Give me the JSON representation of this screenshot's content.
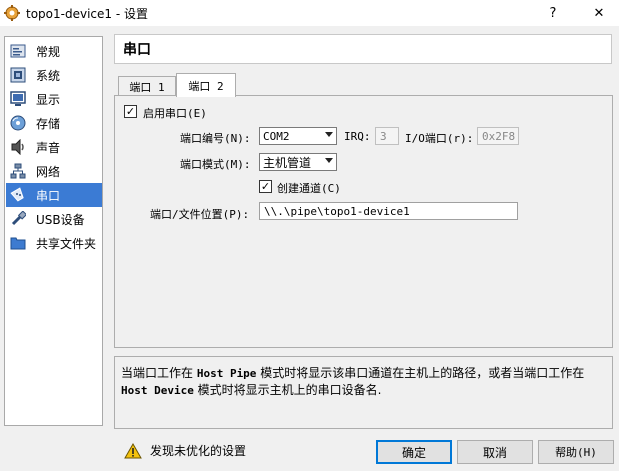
{
  "window": {
    "title": "topo1-device1 - 设置",
    "help_glyph": "?",
    "close_glyph": "✕"
  },
  "sidebar": {
    "items": [
      {
        "label": "常规",
        "icon": "general-icon"
      },
      {
        "label": "系统",
        "icon": "system-icon"
      },
      {
        "label": "显示",
        "icon": "display-icon"
      },
      {
        "label": "存储",
        "icon": "storage-icon"
      },
      {
        "label": "声音",
        "icon": "audio-icon"
      },
      {
        "label": "网络",
        "icon": "network-icon"
      },
      {
        "label": "串口",
        "icon": "serial-port-icon",
        "selected": true
      },
      {
        "label": "USB设备",
        "icon": "usb-icon"
      },
      {
        "label": "共享文件夹",
        "icon": "shared-folder-icon"
      }
    ]
  },
  "header": {
    "title": "串口"
  },
  "tabs": [
    {
      "label": "端口 1",
      "active": false
    },
    {
      "label": "端口 2",
      "active": true
    }
  ],
  "port": {
    "enable_label": "启用串口(E)",
    "enable_checked": true,
    "port_number_label": "端口编号(N):",
    "port_number_value": "COM2",
    "irq_label": "IRQ:",
    "irq_value": "3",
    "io_label": "I/O端口(r):",
    "io_value": "0x2F8",
    "mode_label": "端口模式(M):",
    "mode_value": "主机管道",
    "create_pipe_label": "创建通道(C)",
    "create_pipe_checked": true,
    "path_label": "端口/文件位置(P):",
    "path_value": "\\\\.\\pipe\\topo1-device1"
  },
  "info": {
    "part1": "当端口工作在 ",
    "term1": "Host Pipe",
    "part2": " 模式时将显示该串口通道在主机上的路径，或者当端口工作在",
    "term2": "Host Device",
    "part3": " 模式时将显示主机上的串口设备名."
  },
  "footer": {
    "warning_text": "发现未优化的设置",
    "ok_label": "确定",
    "cancel_label": "取消",
    "help_label": "帮助(H)"
  },
  "colors": {
    "selection": "#3b7bd4",
    "default_button_border": "#0078d7",
    "warning": "#f4c20d"
  }
}
